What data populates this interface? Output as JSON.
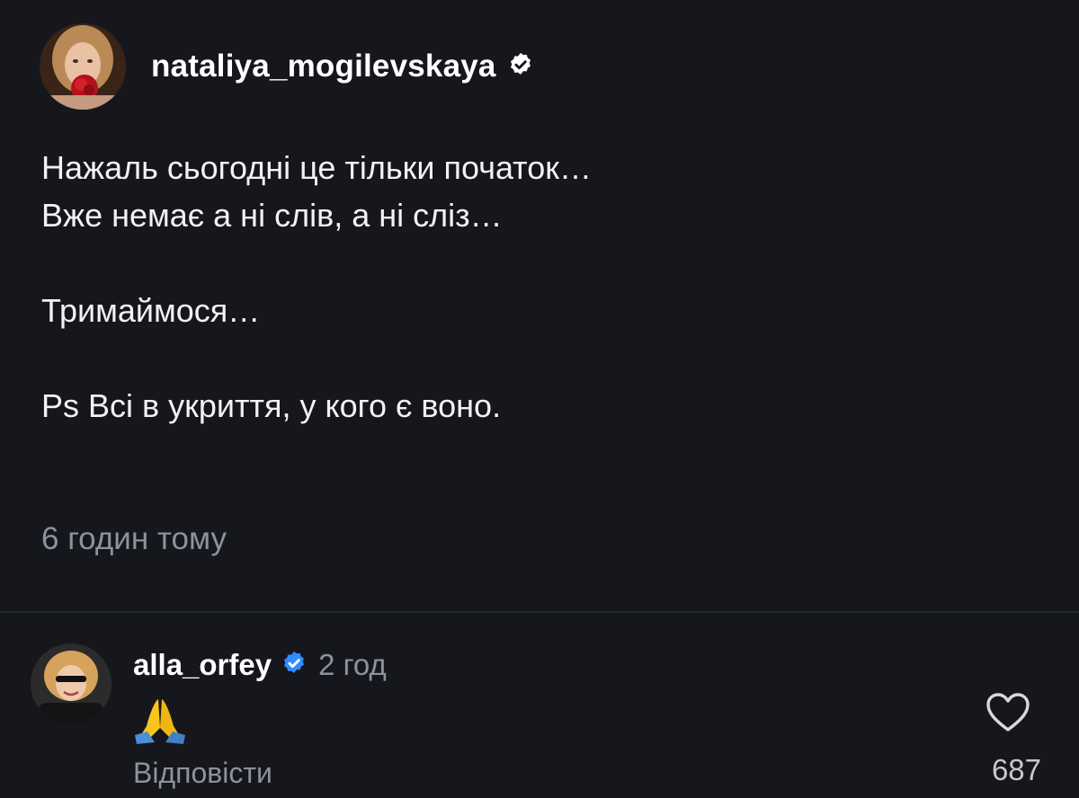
{
  "post": {
    "username": "nataliya_mogilevskaya",
    "verified_icon": "verified-badge-icon",
    "caption_lines": [
      "Нажаль сьогодні це тільки початок…",
      "Вже немає а ні слів, а ні сліз…",
      "",
      "Тримаймося…",
      "",
      "Ps Всі в укриття, у кого є воно."
    ],
    "timestamp": "6 годин тому"
  },
  "comment": {
    "username": "alla_orfey",
    "verified_icon": "verified-badge-icon",
    "time": "2 год",
    "text_emoji": "folded-hands-emoji",
    "reply_label": "Відповісти",
    "like_icon": "heart-outline-icon",
    "like_count": "687"
  },
  "colors": {
    "background": "#15171c",
    "verified_blue": "#2f8cff",
    "text_secondary": "#8e929a"
  }
}
